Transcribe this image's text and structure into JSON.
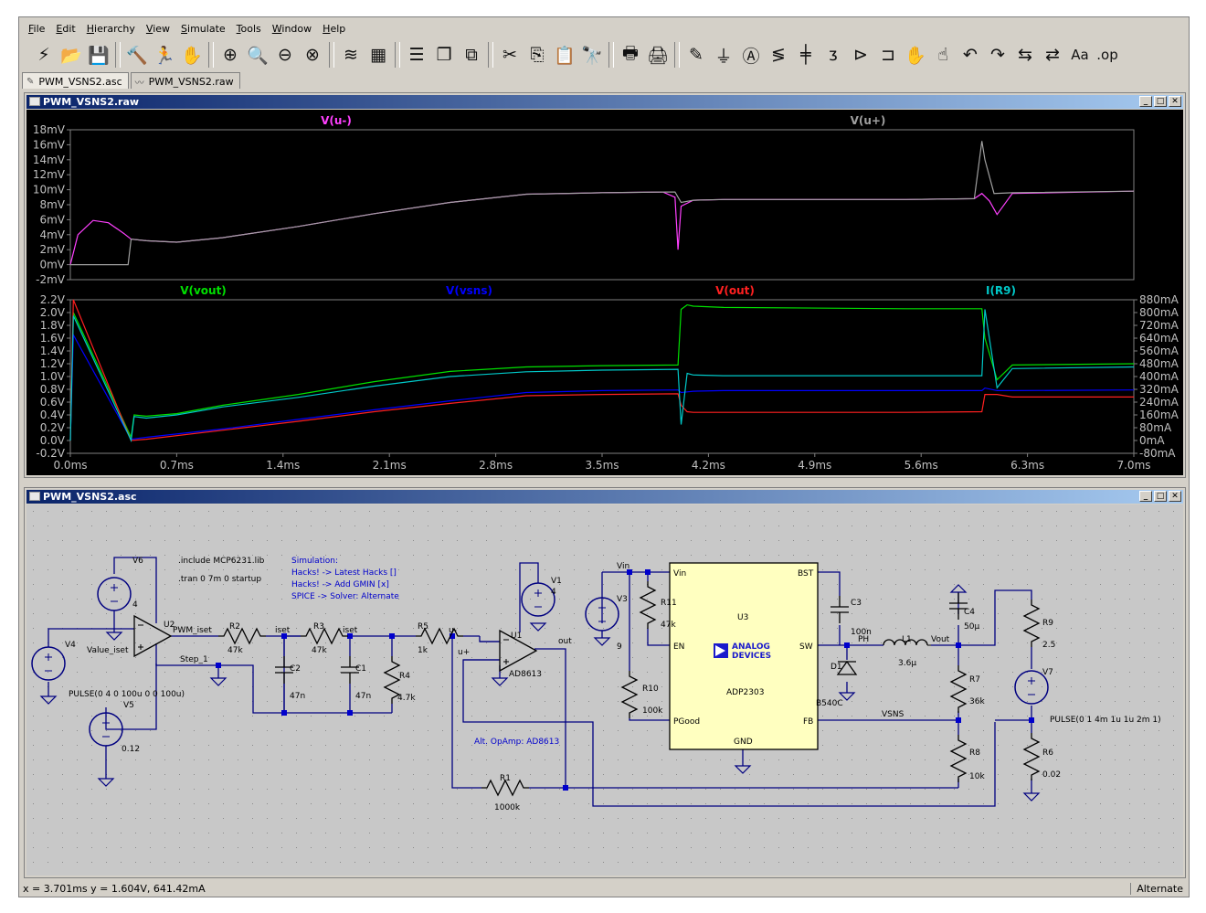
{
  "menu": [
    "File",
    "Edit",
    "Hierarchy",
    "View",
    "Simulate",
    "Tools",
    "Window",
    "Help"
  ],
  "toolbar_icons": [
    {
      "name": "run-icon",
      "glyph": "⚡"
    },
    {
      "name": "open-icon",
      "glyph": "📂"
    },
    {
      "name": "save-icon",
      "glyph": "💾"
    },
    {
      "sep": true
    },
    {
      "name": "control-panel-icon",
      "glyph": "🔨"
    },
    {
      "name": "run-sim-icon",
      "glyph": "🏃"
    },
    {
      "name": "halt-icon",
      "glyph": "✋"
    },
    {
      "sep": true
    },
    {
      "name": "zoom-in-icon",
      "glyph": "⊕"
    },
    {
      "name": "zoom-pan-icon",
      "glyph": "🔍"
    },
    {
      "name": "zoom-out-icon",
      "glyph": "⊖"
    },
    {
      "name": "zoom-fit-icon",
      "glyph": "⊗"
    },
    {
      "sep": true
    },
    {
      "name": "autorange-icon",
      "glyph": "≋"
    },
    {
      "name": "probe-icon",
      "glyph": "▦"
    },
    {
      "sep": true
    },
    {
      "name": "tile-horizontal-icon",
      "glyph": "☰"
    },
    {
      "name": "cascade-icon",
      "glyph": "❐"
    },
    {
      "name": "tile-vertical-icon",
      "glyph": "⧉"
    },
    {
      "sep": true
    },
    {
      "name": "cut-icon",
      "glyph": "✂"
    },
    {
      "name": "copy-icon",
      "glyph": "⎘"
    },
    {
      "name": "paste-icon",
      "glyph": "📋"
    },
    {
      "name": "find-icon",
      "glyph": "🔭"
    },
    {
      "sep": true
    },
    {
      "name": "print-preview-icon",
      "glyph": "🖶"
    },
    {
      "name": "print-icon",
      "glyph": "🖨"
    },
    {
      "sep": true
    },
    {
      "name": "draw-wire-icon",
      "glyph": "✎"
    },
    {
      "name": "ground-icon",
      "glyph": "⏚"
    },
    {
      "name": "label-net-icon",
      "glyph": "Ⓐ"
    },
    {
      "name": "resistor-icon",
      "glyph": "≶"
    },
    {
      "name": "capacitor-icon",
      "glyph": "╪"
    },
    {
      "name": "inductor-icon",
      "glyph": "ᴣ"
    },
    {
      "name": "diode-icon",
      "glyph": "⊳"
    },
    {
      "name": "component-icon",
      "glyph": "⊐"
    },
    {
      "name": "move-icon",
      "glyph": "✋"
    },
    {
      "name": "drag-icon",
      "glyph": "☝"
    },
    {
      "name": "undo-icon",
      "glyph": "↶"
    },
    {
      "name": "redo-icon",
      "glyph": "↷"
    },
    {
      "name": "rotate-icon",
      "glyph": "⇆"
    },
    {
      "name": "mirror-icon",
      "glyph": "⇄"
    },
    {
      "name": "text-icon",
      "glyph": "Aa"
    },
    {
      "name": "spice-directive-icon",
      "glyph": ".op"
    }
  ],
  "tabs": [
    {
      "label": "PWM_VSNS2.asc",
      "icon": "✎"
    },
    {
      "label": "PWM_VSNS2.raw",
      "icon": "〰"
    }
  ],
  "wave_window": {
    "title": "PWM_VSNS2.raw"
  },
  "schematic_window": {
    "title": "PWM_VSNS2.asc"
  },
  "chart_data": [
    {
      "type": "line",
      "title": "",
      "xlabel": "",
      "ylabel": "",
      "xlim": [
        0,
        7.0
      ],
      "ylim": [
        -2,
        18
      ],
      "y_ticks": [
        "18mV",
        "16mV",
        "14mV",
        "12mV",
        "10mV",
        "8mV",
        "6mV",
        "4mV",
        "2mV",
        "0mV",
        "-2mV"
      ],
      "series": [
        {
          "name": "V(u-)",
          "color": "#ff40ff",
          "x": [
            0,
            0.05,
            0.15,
            0.25,
            0.35,
            0.4,
            0.5,
            0.7,
            1.0,
            1.5,
            2.0,
            2.5,
            3.0,
            3.5,
            3.9,
            3.98,
            4.0,
            4.02,
            4.1,
            4.3,
            4.7,
            5.5,
            5.95,
            6.0,
            6.05,
            6.1,
            6.2,
            7.0
          ],
          "y": [
            0,
            4,
            5.9,
            5.6,
            4.2,
            3.4,
            3.2,
            3.0,
            3.6,
            5.1,
            6.8,
            8.3,
            9.4,
            9.6,
            9.7,
            9.0,
            2.0,
            7.8,
            8.6,
            8.7,
            8.7,
            8.7,
            8.8,
            9.5,
            8.5,
            6.7,
            9.5,
            9.8
          ]
        },
        {
          "name": "V(u+)",
          "color": "#a0a0a0",
          "x": [
            0,
            0.38,
            0.4,
            0.5,
            0.7,
            1.0,
            1.5,
            2.0,
            2.5,
            3.0,
            3.5,
            3.9,
            3.98,
            4.02,
            4.1,
            4.3,
            4.7,
            5.5,
            5.95,
            6.0,
            6.02,
            6.08,
            6.2,
            7.0
          ],
          "y": [
            0,
            0,
            3.4,
            3.2,
            3.0,
            3.6,
            5.1,
            6.8,
            8.3,
            9.4,
            9.6,
            9.7,
            9.7,
            8.3,
            8.6,
            8.7,
            8.7,
            8.7,
            8.8,
            16.5,
            14.0,
            9.5,
            9.6,
            9.8
          ]
        }
      ]
    },
    {
      "type": "line",
      "title": "",
      "xlabel": "",
      "ylabel": "",
      "xlim": [
        0,
        7.0
      ],
      "ylim": [
        -0.2,
        2.2
      ],
      "y2lim": [
        -80,
        880
      ],
      "x_ticks": [
        "0.0ms",
        "0.7ms",
        "1.4ms",
        "2.1ms",
        "2.8ms",
        "3.5ms",
        "4.2ms",
        "4.9ms",
        "5.6ms",
        "6.3ms",
        "7.0ms"
      ],
      "y_ticks": [
        "2.2V",
        "2.0V",
        "1.8V",
        "1.6V",
        "1.4V",
        "1.2V",
        "1.0V",
        "0.8V",
        "0.6V",
        "0.4V",
        "0.2V",
        "0.0V",
        "-0.2V"
      ],
      "y2_ticks": [
        "880mA",
        "800mA",
        "720mA",
        "640mA",
        "560mA",
        "480mA",
        "400mA",
        "320mA",
        "240mA",
        "160mA",
        "80mA",
        "0mA",
        "-80mA"
      ],
      "series": [
        {
          "name": "V(vout)",
          "color": "#00e000",
          "axis": "left",
          "x": [
            0,
            0.02,
            0.4,
            0.42,
            0.5,
            0.7,
            1.0,
            1.5,
            2.0,
            2.5,
            3.0,
            3.5,
            4.0,
            4.02,
            4.06,
            4.1,
            4.3,
            5.5,
            6.0,
            6.02,
            6.1,
            6.2,
            7.0
          ],
          "y": [
            0,
            2.0,
            0.05,
            0.4,
            0.38,
            0.42,
            0.55,
            0.72,
            0.92,
            1.08,
            1.15,
            1.17,
            1.18,
            2.05,
            2.12,
            2.1,
            2.08,
            2.06,
            2.06,
            1.6,
            0.95,
            1.18,
            1.2
          ]
        },
        {
          "name": "V(vsns)",
          "color": "#0000ff",
          "axis": "left",
          "x": [
            0,
            0.02,
            0.4,
            0.5,
            1.0,
            1.5,
            2.0,
            2.5,
            3.0,
            3.5,
            4.0,
            4.02,
            4.06,
            4.1,
            4.3,
            5.5,
            6.0,
            6.02,
            6.1,
            6.2,
            7.0
          ],
          "y": [
            0,
            1.65,
            0.02,
            0.05,
            0.18,
            0.33,
            0.48,
            0.62,
            0.75,
            0.78,
            0.79,
            0.75,
            0.76,
            0.77,
            0.78,
            0.78,
            0.78,
            0.82,
            0.78,
            0.78,
            0.79
          ]
        },
        {
          "name": "V(out)",
          "color": "#ff2020",
          "axis": "left",
          "x": [
            0,
            0.02,
            0.4,
            0.5,
            1.0,
            1.5,
            2.0,
            2.5,
            3.0,
            3.5,
            4.0,
            4.02,
            4.06,
            4.1,
            4.3,
            5.5,
            6.0,
            6.02,
            6.1,
            6.2,
            7.0
          ],
          "y": [
            0,
            2.2,
            0,
            0.02,
            0.16,
            0.3,
            0.45,
            0.58,
            0.7,
            0.72,
            0.73,
            0.55,
            0.45,
            0.44,
            0.44,
            0.44,
            0.45,
            0.72,
            0.72,
            0.68,
            0.68
          ]
        },
        {
          "name": "I(R9)",
          "color": "#00c8c8",
          "axis": "right",
          "x": [
            0,
            0.02,
            0.4,
            0.42,
            0.5,
            0.7,
            1.0,
            1.5,
            2.0,
            2.5,
            3.0,
            3.5,
            4.0,
            4.02,
            4.06,
            4.1,
            4.3,
            5.5,
            6.0,
            6.02,
            6.1,
            6.2,
            7.0
          ],
          "y": [
            0,
            780,
            0,
            150,
            140,
            160,
            210,
            270,
            340,
            400,
            430,
            440,
            445,
            100,
            420,
            410,
            405,
            405,
            405,
            820,
            330,
            450,
            460
          ]
        }
      ]
    }
  ],
  "schematic": {
    "texts": {
      "include": ".include MCP6231.lib",
      "tran": ".tran 0 7m 0 startup",
      "sim_head": "Simulation:",
      "sim1": "Hacks! -> Latest Hacks []",
      "sim2": "Hacks! -> Add GMIN [x]",
      "sim3": "SPICE -> Solver: Alternate",
      "alt_opamp": "Alt. OpAmp: AD8613",
      "v4_pulse": "PULSE(0 4 0 100u 0 0 100u)",
      "v7_pulse": "PULSE(0 1 4m 1u 1u 2m 1)"
    },
    "parts": {
      "V6": "V6",
      "V6_val": "4",
      "V4": "V4",
      "V5": "V5",
      "V5_val": "0.12",
      "U2": "U2",
      "R2": "R2",
      "R2_val": "47k",
      "R3": "R3",
      "R3_val": "47k",
      "R5": "R5",
      "R5_val": "1k",
      "R4": "R4",
      "R4_val": "4.7k",
      "C2": "C2",
      "C2_val": "47n",
      "C1": "C1",
      "C1_val": "47n",
      "U1": "U1",
      "U1_model": "AD8613",
      "V1": "V1",
      "V1_val": "4",
      "R1": "R1",
      "R1_val": "1000k",
      "V3": "V3",
      "V3_val": "9",
      "R11": "R11",
      "R11_val": "47k",
      "R10": "R10",
      "R10_val": "100k",
      "U3": "U3",
      "U3_model": "ADP2303",
      "C3": "C3",
      "C3_val": "100n",
      "D1": "D1",
      "D1_model": "B540C",
      "L1": "L1",
      "L1_val": "3.6µ",
      "C4": "C4",
      "C4_val": "50µ",
      "R7": "R7",
      "R7_val": "36k",
      "R8": "R8",
      "R8_val": "10k",
      "R9": "R9",
      "R9_val": "2.5",
      "R6": "R6",
      "R6_val": "0.02",
      "V7": "V7"
    },
    "nets": {
      "value_iset": "Value_iset",
      "pwm_iset": "PWM_iset",
      "step1": "Step_1",
      "iset1": "iset",
      "iset2": "iset",
      "u_minus": "u-",
      "u_plus": "u+",
      "out": "out",
      "vin": "Vin",
      "ph": "PH",
      "vout": "Vout",
      "vsns": "VSNS"
    },
    "pins": {
      "vin": "Vin",
      "en": "EN",
      "pgood": "PGood",
      "bst": "BST",
      "sw": "SW",
      "fb": "FB",
      "gnd": "GND"
    },
    "logo": {
      "line1": "ANALOG",
      "line2": "DEVICES"
    }
  },
  "status": {
    "coords": "x = 3.701ms    y = 1.604V, 641.42mA",
    "mode": "Alternate"
  }
}
